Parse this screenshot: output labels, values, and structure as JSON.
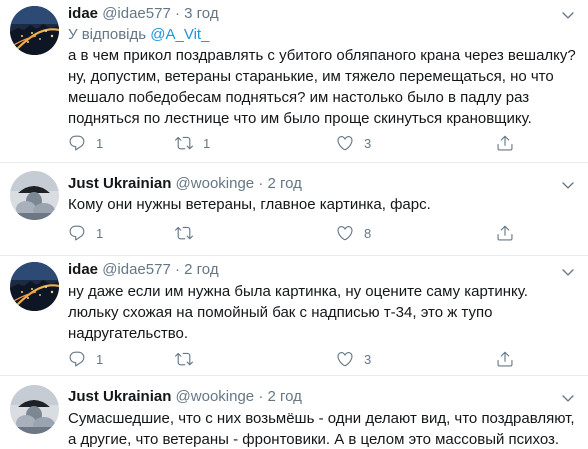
{
  "tweets": [
    {
      "name": "idae",
      "handle": "@idae577",
      "dot": "·",
      "time": "3 год",
      "reply_prefix": "У відповідь",
      "reply_mention": "@A_Vit_",
      "lines": [
        "а в чем прикол поздравлять с убитого обляпаного крана через вешалку?",
        "ну, допустим, ветераны старанькие, им тяжело перемещаться, но что",
        "мешало победобесам подняться? им настолько было в падлу раз",
        "подняться по лестнице что им было проще скинуться крановщику."
      ],
      "reply_count": "1",
      "retweet_count": "1",
      "like_count": "3",
      "avatar_icon": "city-night-avatar"
    },
    {
      "name": "Just Ukrainian",
      "handle": "@wookinge",
      "dot": "·",
      "time": "2 год",
      "lines": [
        "Кому они нужны ветераны, главное картинка, фарс."
      ],
      "reply_count": "1",
      "retweet_count": "",
      "like_count": "8",
      "avatar_icon": "umbrella-avatar"
    },
    {
      "name": "idae",
      "handle": "@idae577",
      "dot": "·",
      "time": "2 год",
      "lines": [
        "ну даже если им нужна была картинка, ну оцените саму картинку.",
        "люльку схожая на помойный бак с надписью т-34, это ж тупо",
        "надругательство."
      ],
      "reply_count": "1",
      "retweet_count": "",
      "like_count": "3",
      "avatar_icon": "city-night-avatar"
    },
    {
      "name": "Just Ukrainian",
      "handle": "@wookinge",
      "dot": "·",
      "time": "2 год",
      "lines": [
        "Сумасшедшие, что с них возьмёшь - одни делают вид, что поздравляют,",
        "а другие, что ветераны - фронтовики. А в целом это массовый психоз."
      ],
      "avatar_icon": "umbrella-avatar"
    }
  ],
  "colors": {
    "text": "#14171a",
    "secondary": "#657786",
    "link": "#1b95e0",
    "divider": "#e6ecf0"
  }
}
